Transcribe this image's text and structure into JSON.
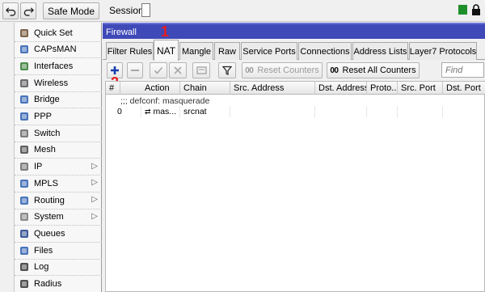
{
  "toolbar": {
    "safe_mode_label": "Safe Mode",
    "session_label": "Session:"
  },
  "sidebar": {
    "items": [
      {
        "label": "Quick Set",
        "icon": "quick-set-icon"
      },
      {
        "label": "CAPsMAN",
        "icon": "capsman-icon"
      },
      {
        "label": "Interfaces",
        "icon": "interfaces-icon"
      },
      {
        "label": "Wireless",
        "icon": "wireless-icon"
      },
      {
        "label": "Bridge",
        "icon": "bridge-icon"
      },
      {
        "label": "PPP",
        "icon": "ppp-icon"
      },
      {
        "label": "Switch",
        "icon": "switch-icon"
      },
      {
        "label": "Mesh",
        "icon": "mesh-icon"
      },
      {
        "label": "IP",
        "icon": "ip-icon",
        "submenu": true
      },
      {
        "label": "MPLS",
        "icon": "mpls-icon",
        "submenu": true
      },
      {
        "label": "Routing",
        "icon": "routing-icon",
        "submenu": true
      },
      {
        "label": "System",
        "icon": "system-icon",
        "submenu": true
      },
      {
        "label": "Queues",
        "icon": "queues-icon"
      },
      {
        "label": "Files",
        "icon": "files-icon"
      },
      {
        "label": "Log",
        "icon": "log-icon"
      },
      {
        "label": "Radius",
        "icon": "radius-icon"
      }
    ]
  },
  "window": {
    "title": "Firewall",
    "tabs": [
      "Filter Rules",
      "NAT",
      "Mangle",
      "Raw",
      "Service Ports",
      "Connections",
      "Address Lists",
      "Layer7 Protocols"
    ],
    "active_tab": "NAT",
    "buttons": {
      "reset_counters": "Reset Counters",
      "reset_all_counters": "Reset All Counters",
      "oo": "00"
    },
    "find_placeholder": "Find",
    "annotations": {
      "one": "1",
      "two": "2"
    }
  },
  "table": {
    "columns": [
      "#",
      "Action",
      "Chain",
      "Src. Address",
      "Dst. Address",
      "Proto...",
      "Src. Port",
      "Dst. Port"
    ],
    "comment": ";;; defconf: masquerade",
    "rows": [
      {
        "num": "0",
        "action": "mas...",
        "chain": "srcnat",
        "src": "",
        "dst": "",
        "proto": "",
        "sport": "",
        "dport": ""
      }
    ]
  },
  "colors": {
    "title_bar": "#3f49b8",
    "annotation": "#e81c1c",
    "add_button": "#1a3fb0",
    "status_green": "#1f8f2a"
  }
}
